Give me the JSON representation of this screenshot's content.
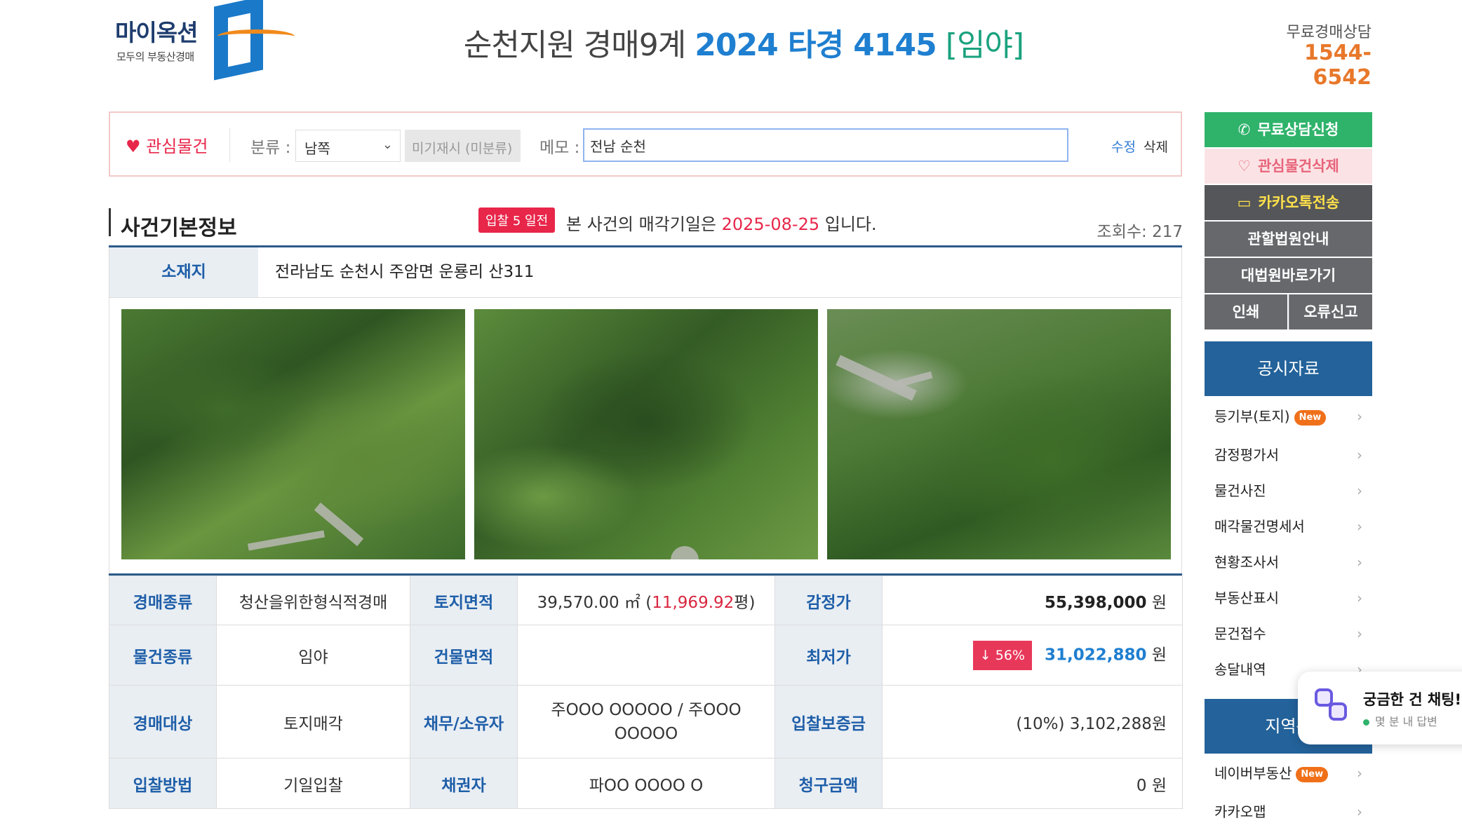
{
  "header": {
    "logo_text": "마이옥션",
    "logo_sub": "모두의 부동산경매",
    "court_title": "순천지원 경매9계",
    "case_number": "2024 타경 4145",
    "property_kind_bracket": "[임야]",
    "consult_label": "무료경매상담",
    "consult_phone": "1544-6542"
  },
  "interest": {
    "heart_icon": "♥",
    "label": "관심물건",
    "category_label": "분류 :",
    "category_value": "남쪽",
    "unclassified": "미기재시 (미분류)",
    "memo_label": "메모 :",
    "memo_value": "전남 순천",
    "edit": "수정",
    "delete": "삭제"
  },
  "section": {
    "title": "사건기본정보",
    "badge": "입찰 5 일전",
    "sentence_pre": "본 사건의 매각기일은",
    "sale_date": "2025-08-25",
    "sentence_post": "입니다.",
    "view_count": "조회수: 217",
    "location_label": "소재지",
    "location_value": "전라남도 순천시 주암면 운룡리 산311"
  },
  "info": {
    "r1": {
      "h1": "경매종류",
      "v1": "청산을위한형식적경매",
      "h2": "토지면적",
      "v2a": "39,570.00 ㎡ (",
      "v2b": "11,969.92",
      "v2c": "평)",
      "h3": "감정가",
      "v3a": "55,398,000",
      "v3b": "원"
    },
    "r2": {
      "h1": "물건종류",
      "v1": "임야",
      "h2": "건물면적",
      "v2": "",
      "h3": "최저가",
      "badge": "↓ 56%",
      "v3a": "31,022,880",
      "v3b": "원"
    },
    "r3": {
      "h1": "경매대상",
      "v1": "토지매각",
      "h2": "채무/소유자",
      "v2": "주OOO OOOOO / 주OOO OOOOO",
      "h3": "입찰보증금",
      "v3": "(10%) 3,102,288원"
    },
    "r4": {
      "h1": "입찰방법",
      "v1": "기일입찰",
      "h2": "채권자",
      "v2": "파OO OOOO O",
      "h3": "청구금액",
      "v3": "0 원"
    }
  },
  "sidebar": {
    "consult": "무료상담신청",
    "unwatch": "관심물건삭제",
    "kakao": "카카오톡전송",
    "court": "관할법원안내",
    "supreme": "대법원바로가기",
    "print": "인쇄",
    "report": "오류신고",
    "notice_head": "공시자료",
    "notice_items": [
      "등기부(토지)",
      "감정평가서",
      "물건사진",
      "매각물건명세서",
      "현황조사서",
      "부동산표시",
      "문건접수",
      "송달내역"
    ],
    "new_badge": "New",
    "region_head": "지역분",
    "region_items": [
      "네이버부동산",
      "카카오맵"
    ]
  },
  "chat": {
    "title": "궁금한 건 채팅!",
    "sub": "몇 분 내 답변"
  },
  "colors": {
    "accent_blue": "#1f7fd0",
    "accent_red": "#e8264a",
    "accent_green": "#2fb36b",
    "nav_blue": "#23629a",
    "orange": "#e8782a"
  }
}
